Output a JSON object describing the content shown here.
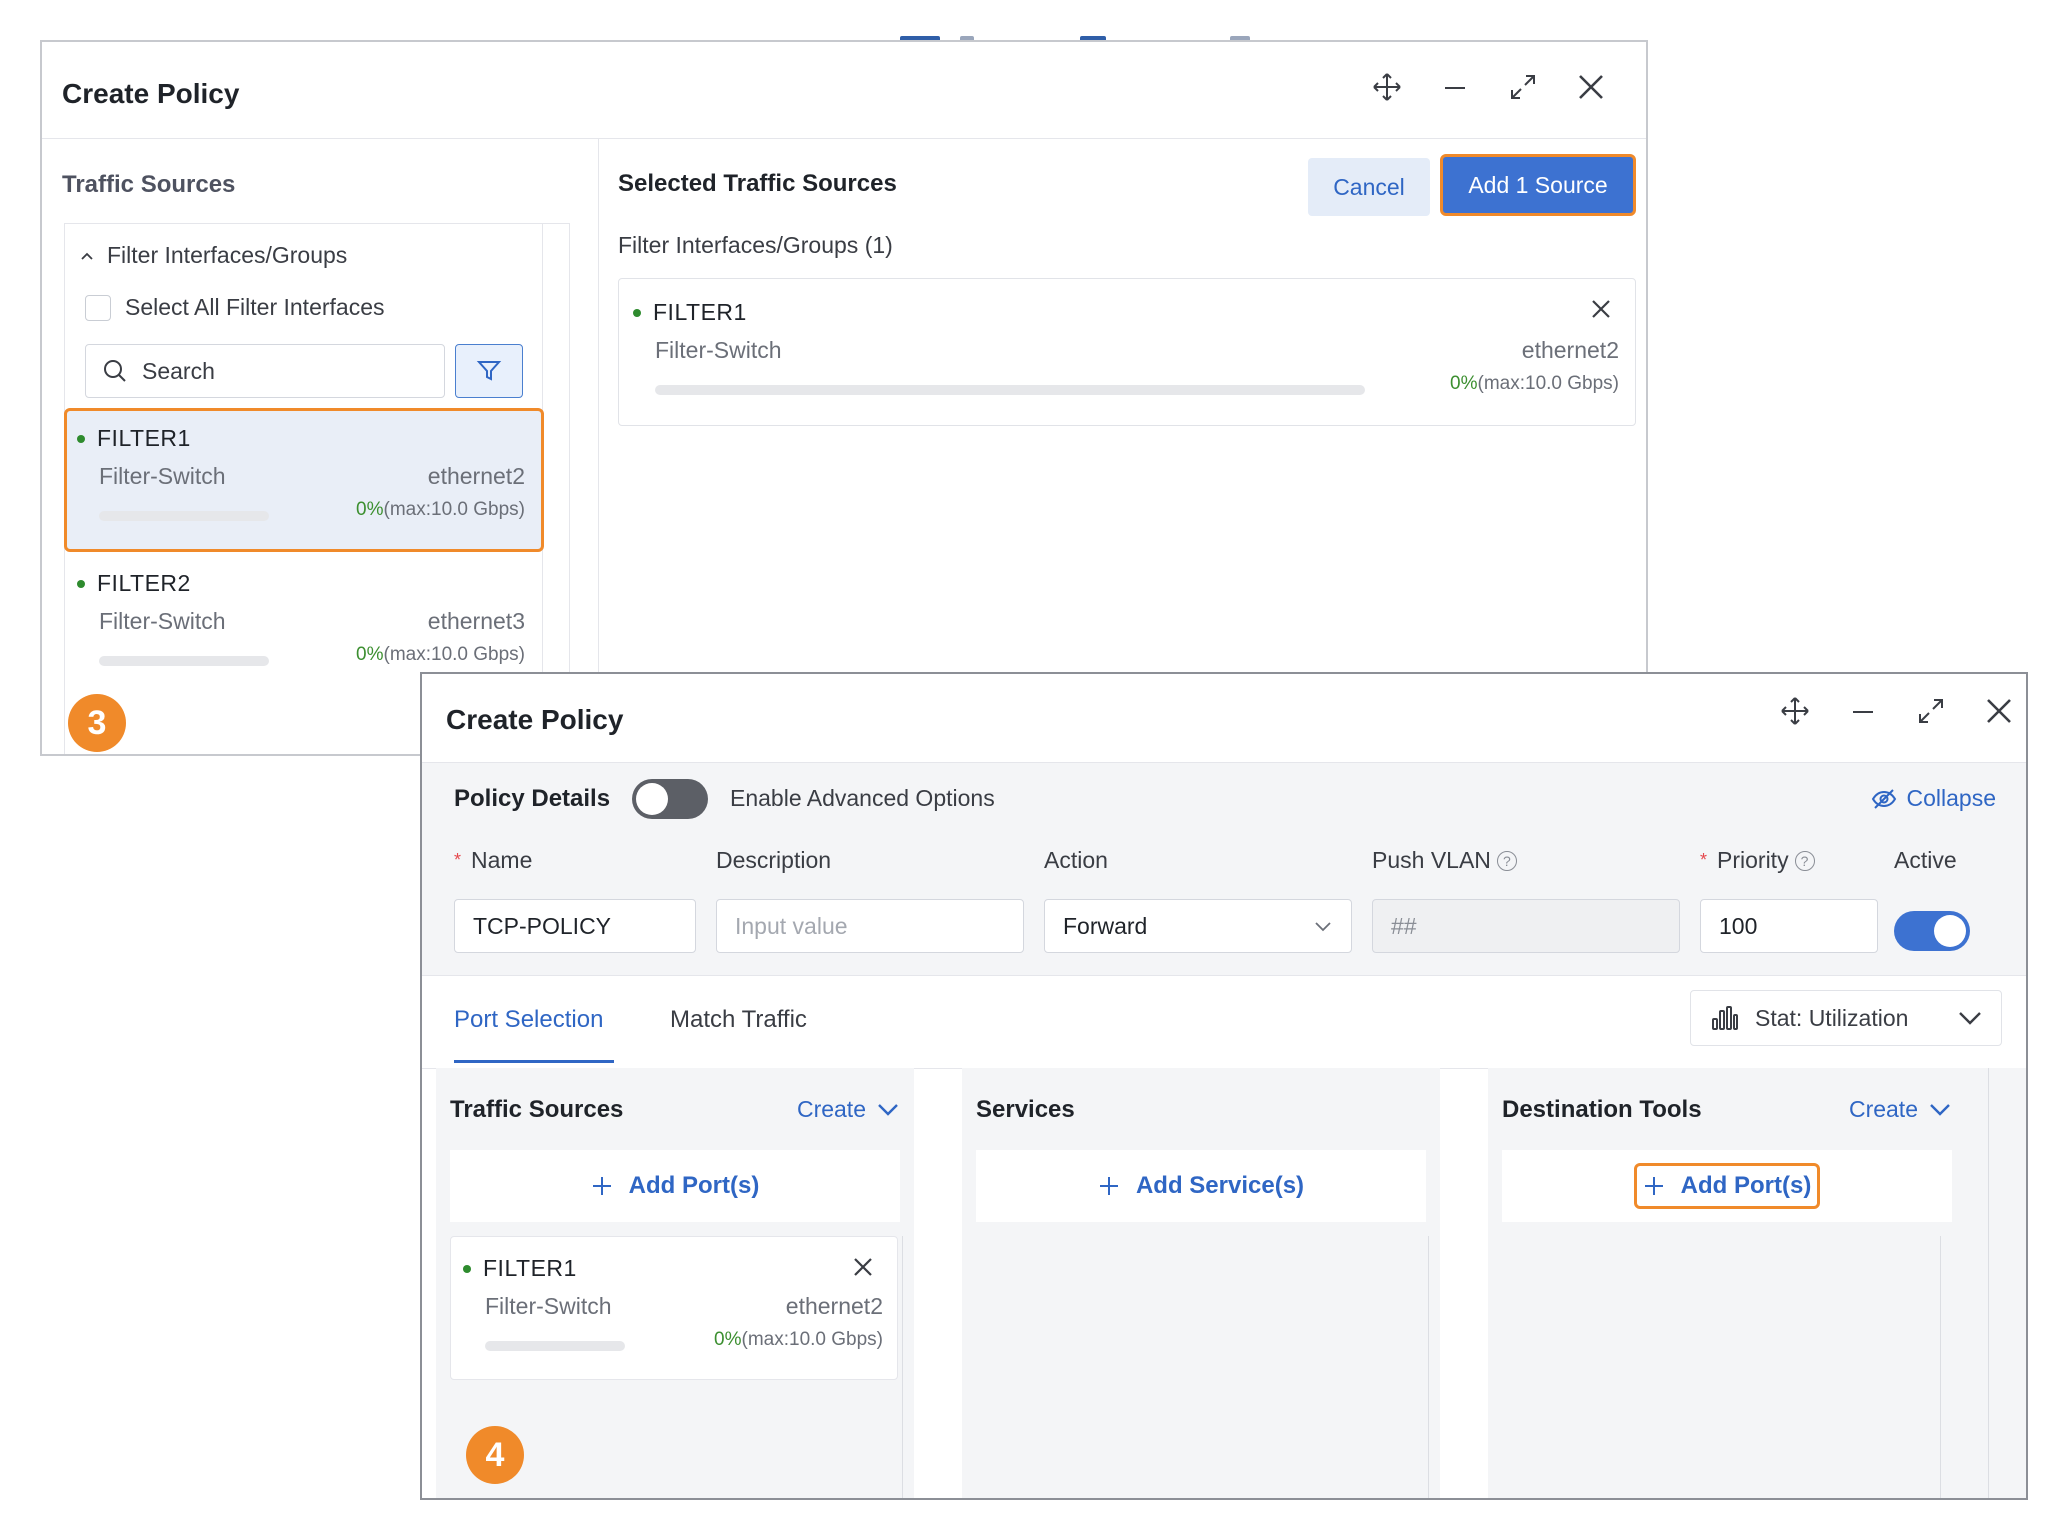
{
  "dialog1": {
    "title": "Create Policy",
    "left": {
      "title": "Traffic Sources",
      "group_toggle": "Filter Interfaces/Groups",
      "select_all": "Select All Filter Interfaces",
      "search_placeholder": "Search",
      "items": [
        {
          "name": "FILTER1",
          "type": "Filter-Switch",
          "iface": "ethernet2",
          "pct": "0%",
          "max": "(max:10.0 Gbps)"
        },
        {
          "name": "FILTER2",
          "type": "Filter-Switch",
          "iface": "ethernet3",
          "pct": "0%",
          "max": "(max:10.0 Gbps)"
        }
      ]
    },
    "right": {
      "title": "Selected Traffic Sources",
      "cancel": "Cancel",
      "add": "Add 1 Source",
      "subtitle": "Filter Interfaces/Groups (1)",
      "selected": {
        "name": "FILTER1",
        "type": "Filter-Switch",
        "iface": "ethernet2",
        "pct": "0%",
        "max": "(max:10.0 Gbps)"
      }
    },
    "step": "3"
  },
  "dialog2": {
    "title": "Create Policy",
    "details": {
      "label": "Policy Details",
      "advanced": "Enable Advanced Options",
      "collapse": "Collapse",
      "fields": {
        "name_label": "Name",
        "name_value": "TCP-POLICY",
        "desc_label": "Description",
        "desc_placeholder": "Input value",
        "action_label": "Action",
        "action_value": "Forward",
        "vlan_label": "Push VLAN",
        "vlan_value": "##",
        "priority_label": "Priority",
        "priority_value": "100",
        "active_label": "Active"
      },
      "active_on": true,
      "advanced_on": false
    },
    "tabs": [
      "Port Selection",
      "Match Traffic"
    ],
    "stat": "Stat: Utilization",
    "columns": {
      "sources": {
        "title": "Traffic Sources",
        "create": "Create",
        "add": "Add Port(s)"
      },
      "services": {
        "title": "Services",
        "add": "Add Service(s)"
      },
      "tools": {
        "title": "Destination Tools",
        "create": "Create",
        "add": "Add Port(s)"
      }
    },
    "source_card": {
      "name": "FILTER1",
      "type": "Filter-Switch",
      "iface": "ethernet2",
      "pct": "0%",
      "max": "(max:10.0 Gbps)"
    },
    "step": "4"
  },
  "colors": {
    "accent": "#3d72d1",
    "highlight": "#f08a2a",
    "status_green": "#2e8b2e"
  }
}
